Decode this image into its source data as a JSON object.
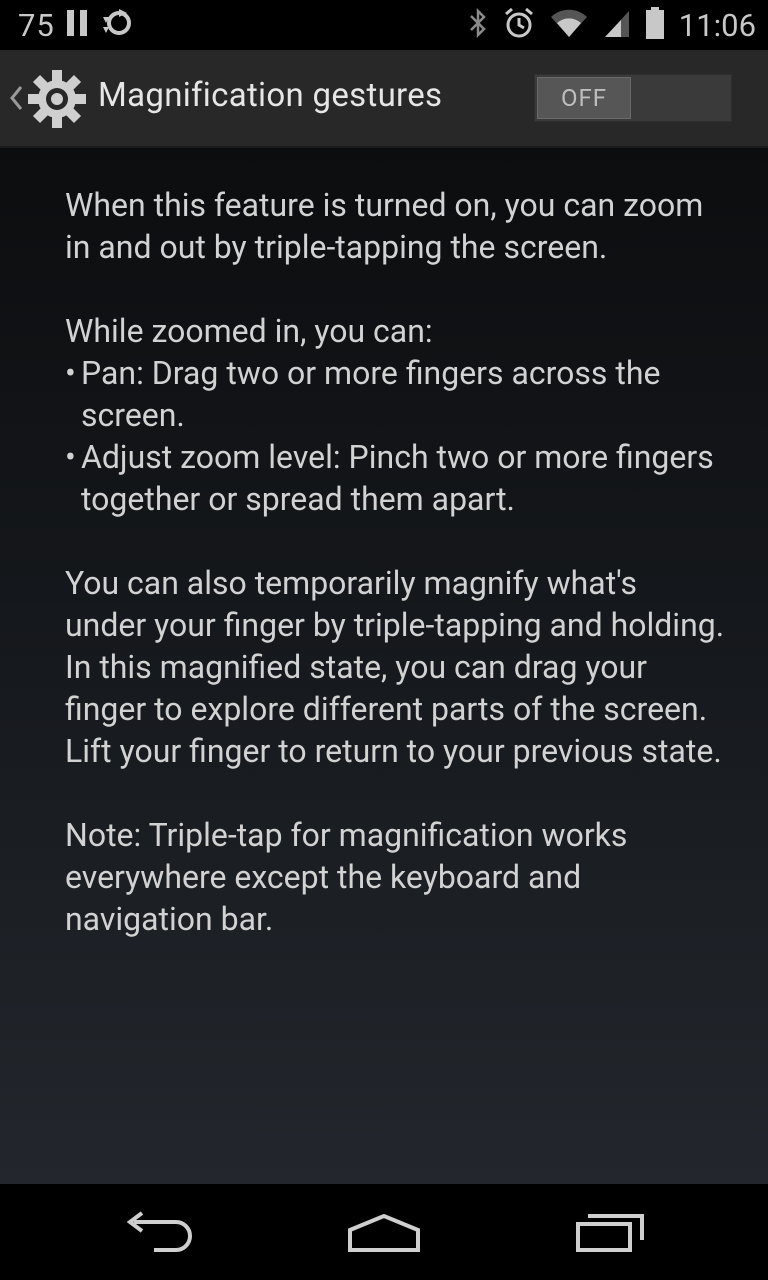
{
  "status_bar": {
    "left_number": "75",
    "time": "11:06",
    "icons": [
      "pause-bars-icon",
      "sync-icon",
      "bluetooth-icon",
      "alarm-icon",
      "wifi-icon",
      "signal-icon",
      "battery-icon"
    ]
  },
  "action_bar": {
    "title": "Magnification gestures",
    "toggle_label": "OFF",
    "toggle_state": "off"
  },
  "content": {
    "intro": "When this feature is turned on, you can zoom in and out by triple-tapping the screen.",
    "zoomed_heading": "While zoomed in, you can:",
    "bullets": [
      "Pan: Drag two or more fingers across the screen.",
      "Adjust zoom level: Pinch two or more fingers together or spread them apart."
    ],
    "temporary": "You can also temporarily magnify what's under your finger by triple-tapping and holding. In this magnified state, you can drag your finger to explore different parts of the screen. Lift your finger to return to your previous state.",
    "note": "Note: Triple-tap for magnification works everywhere except the keyboard and navigation bar."
  },
  "colors": {
    "action_bar_bg": "#282828",
    "content_top": "#0c0d0f",
    "content_bottom": "#23272d",
    "text": "#d2d2d2"
  }
}
